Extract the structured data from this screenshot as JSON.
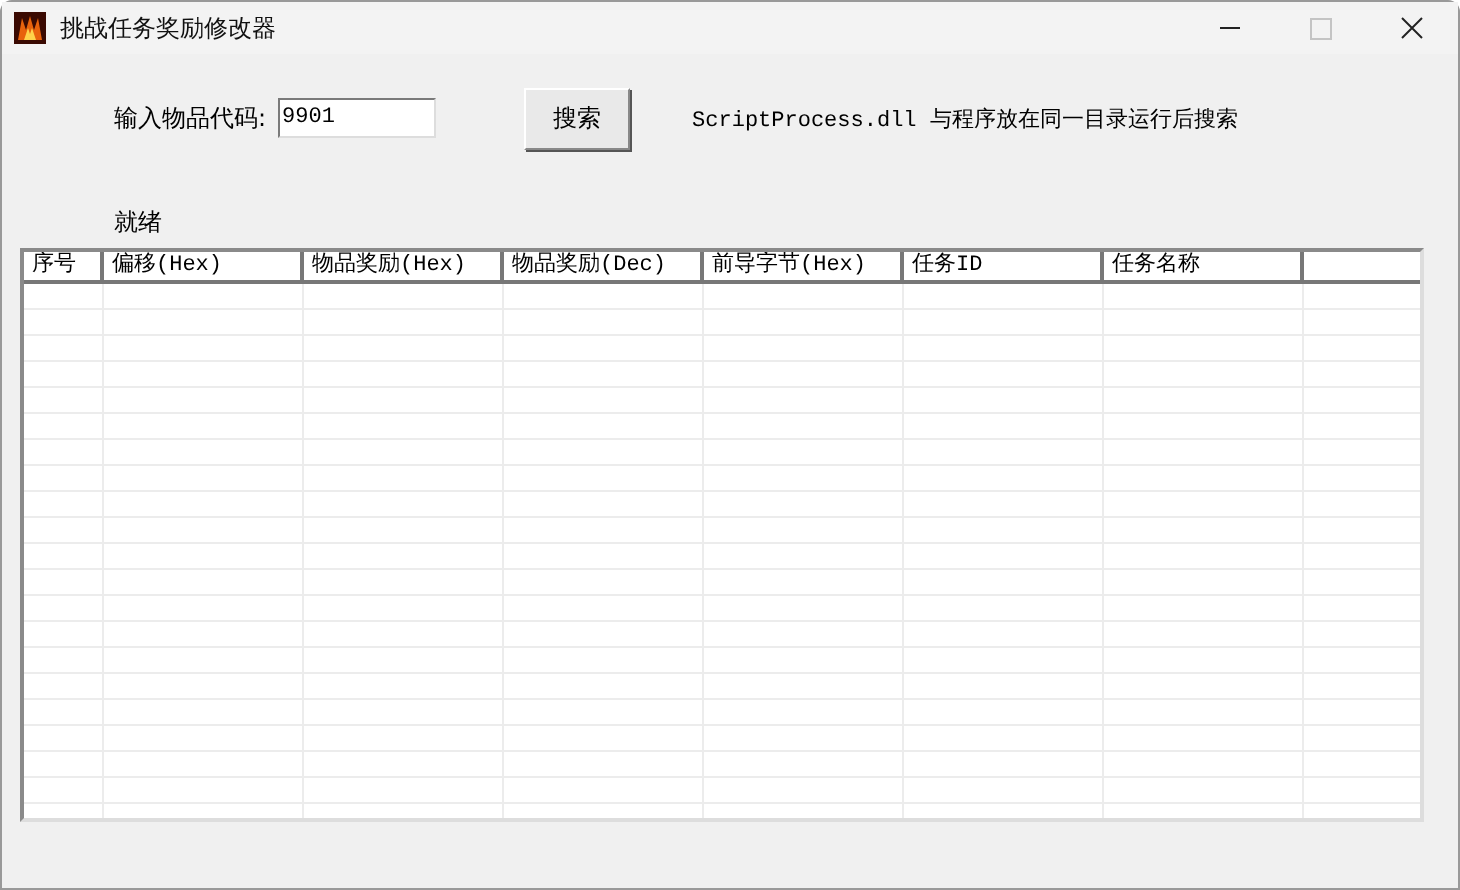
{
  "window": {
    "title": "挑战任务奖励修改器",
    "maximize_disabled": true
  },
  "search": {
    "label": "输入物品代码:",
    "value": "9901",
    "button": "搜索",
    "note": "ScriptProcess.dll 与程序放在同一目录运行后搜索"
  },
  "status": "就绪",
  "table": {
    "columns": [
      "序号",
      "偏移(Hex)",
      "物品奖励(Hex)",
      "物品奖励(Dec)",
      "前导字节(Hex)",
      "任务ID",
      "任务名称"
    ]
  }
}
